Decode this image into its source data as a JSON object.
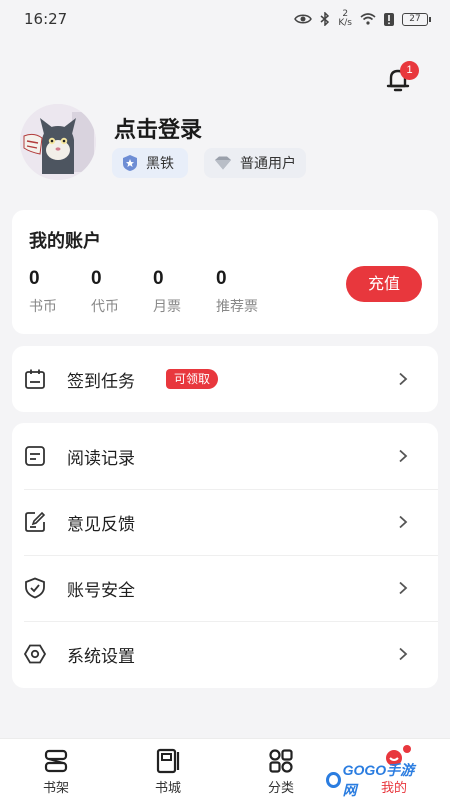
{
  "status_bar": {
    "time": "16:27",
    "net_speed_value": "2",
    "net_speed_unit": "K/s",
    "battery": "27"
  },
  "notifications": {
    "count": "1"
  },
  "profile": {
    "login_prompt": "点击登录",
    "level_badge": "黑铁",
    "user_type_badge": "普通用户"
  },
  "account": {
    "title": "我的账户",
    "stats": [
      {
        "value": "0",
        "label": "书币"
      },
      {
        "value": "0",
        "label": "代币"
      },
      {
        "value": "0",
        "label": "月票"
      },
      {
        "value": "0",
        "label": "推荐票"
      }
    ],
    "recharge_label": "充值"
  },
  "tasks": {
    "label": "签到任务",
    "claim_badge": "可领取",
    "icon": "calendar-icon"
  },
  "menu": [
    {
      "label": "阅读记录",
      "icon": "reading-record-icon"
    },
    {
      "label": "意见反馈",
      "icon": "feedback-icon"
    },
    {
      "label": "账号安全",
      "icon": "shield-icon"
    },
    {
      "label": "系统设置",
      "icon": "settings-icon"
    }
  ],
  "bottom_nav": [
    {
      "label": "书架",
      "icon": "bookshelf-icon"
    },
    {
      "label": "书城",
      "icon": "bookstore-icon"
    },
    {
      "label": "分类",
      "icon": "category-icon"
    },
    {
      "label": "我的",
      "icon": "profile-icon",
      "active": true
    }
  ],
  "watermark": {
    "text": "GOGO手游网"
  },
  "colors": {
    "accent": "#e8373d",
    "background": "#f4f4f6",
    "card": "#ffffff",
    "badge_bg": "#e8eef9"
  }
}
